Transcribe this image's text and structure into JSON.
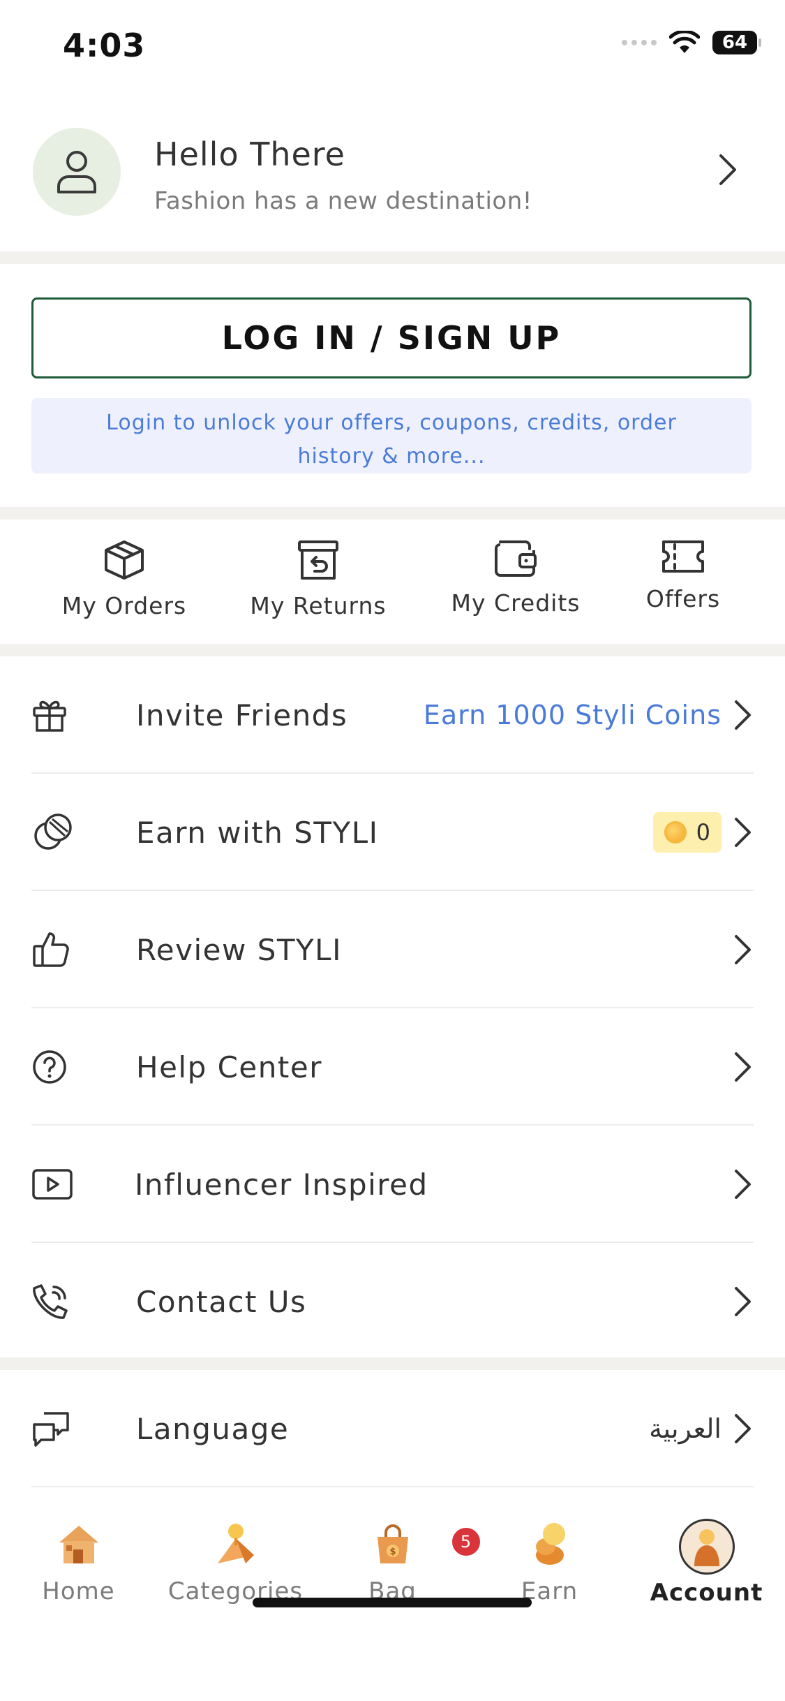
{
  "status_bar": {
    "time": "4:03",
    "battery": "64"
  },
  "profile": {
    "greeting": "Hello There",
    "tagline": "Fashion has a new destination!"
  },
  "login": {
    "button_label": "LOG IN / SIGN UP",
    "info_text": "Login to unlock your offers, coupons, credits, order history & more..."
  },
  "quick_actions": [
    {
      "label": "My Orders",
      "icon": "box-icon"
    },
    {
      "label": "My Returns",
      "icon": "return-box-icon"
    },
    {
      "label": "My Credits",
      "icon": "wallet-icon"
    },
    {
      "label": "Offers",
      "icon": "ticket-icon"
    }
  ],
  "menu": [
    {
      "label": "Invite Friends",
      "icon": "gift-icon",
      "right_text": "Earn 1000 Styli Coins"
    },
    {
      "label": "Earn with STYLI",
      "icon": "coins-icon",
      "coin_count": "0"
    },
    {
      "label": "Review STYLI",
      "icon": "thumbs-up-icon"
    },
    {
      "label": "Help Center",
      "icon": "question-circle-icon"
    },
    {
      "label": "Influencer Inspired",
      "icon": "play-icon"
    },
    {
      "label": "Contact Us",
      "icon": "phone-icon"
    }
  ],
  "settings": [
    {
      "label": "Language",
      "icon": "chat-bubbles-icon",
      "value": "العربية"
    }
  ],
  "tabbar": {
    "tabs": [
      {
        "label": "Home",
        "icon": "home-icon"
      },
      {
        "label": "Categories",
        "icon": "categories-icon"
      },
      {
        "label": "Bag",
        "icon": "bag-icon",
        "badge": "5"
      },
      {
        "label": "Earn",
        "icon": "earn-coins-icon"
      },
      {
        "label": "Account",
        "icon": "account-icon",
        "active": true
      }
    ]
  },
  "colors": {
    "primary_green": "#1d5b39",
    "link_blue": "#4a7bd9",
    "info_bg": "#eef1fd",
    "badge_red": "#d9343a",
    "coin_pill_bg": "#fdefad"
  }
}
